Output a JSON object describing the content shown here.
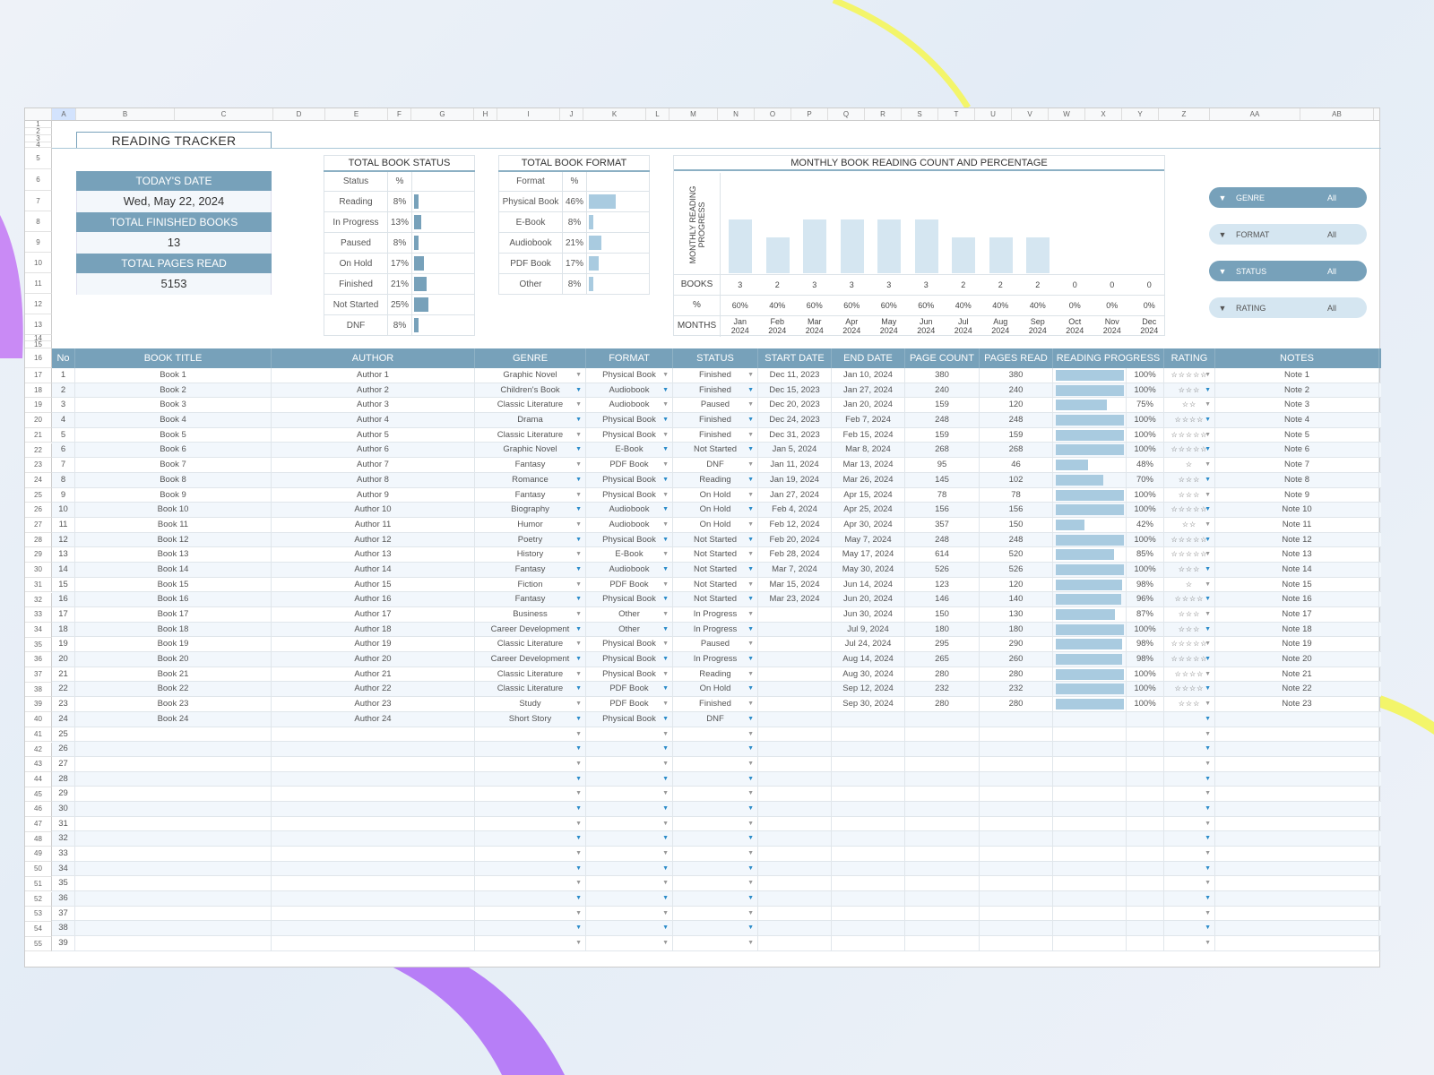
{
  "sheet": {
    "columns": [
      "A",
      "B",
      "C",
      "D",
      "E",
      "F",
      "G",
      "H",
      "I",
      "J",
      "K",
      "L",
      "M",
      "N",
      "O",
      "P",
      "Q",
      "R",
      "S",
      "T",
      "U",
      "V",
      "W",
      "X",
      "Y",
      "Z",
      "AA",
      "AB"
    ],
    "title": "READING TRACKER"
  },
  "kpis": {
    "today_label": "TODAY'S DATE",
    "today_value": "Wed, May 22, 2024",
    "finished_label": "TOTAL FINISHED BOOKS",
    "finished_value": "13",
    "pages_label": "TOTAL PAGES READ",
    "pages_value": "5153"
  },
  "status_summary": {
    "title": "TOTAL BOOK STATUS",
    "col_status": "Status",
    "col_pct": "%",
    "rows": [
      {
        "label": "Reading",
        "pct": "8%",
        "value": 8
      },
      {
        "label": "In Progress",
        "pct": "13%",
        "value": 13
      },
      {
        "label": "Paused",
        "pct": "8%",
        "value": 8
      },
      {
        "label": "On Hold",
        "pct": "17%",
        "value": 17
      },
      {
        "label": "Finished",
        "pct": "21%",
        "value": 21
      },
      {
        "label": "Not Started",
        "pct": "25%",
        "value": 25
      },
      {
        "label": "DNF",
        "pct": "8%",
        "value": 8
      }
    ]
  },
  "format_summary": {
    "title": "TOTAL BOOK FORMAT",
    "col_format": "Format",
    "col_pct": "%",
    "rows": [
      {
        "label": "Physical Book",
        "pct": "46%",
        "value": 46
      },
      {
        "label": "E-Book",
        "pct": "8%",
        "value": 8
      },
      {
        "label": "Audiobook",
        "pct": "21%",
        "value": 21
      },
      {
        "label": "PDF Book",
        "pct": "17%",
        "value": 17
      },
      {
        "label": "Other",
        "pct": "8%",
        "value": 8
      }
    ]
  },
  "chart_data": {
    "type": "bar",
    "title": "MONTHLY BOOK READING COUNT AND PERCENTAGE",
    "ylabel": "MONTHLY READING PROGRESS",
    "row_labels": {
      "books": "BOOKS",
      "pct": "%",
      "months": "MONTHS"
    },
    "categories": [
      "Jan 2024",
      "Feb 2024",
      "Mar 2024",
      "Apr 2024",
      "May 2024",
      "Jun 2024",
      "Jul 2024",
      "Aug 2024",
      "Sep 2024",
      "Oct 2024",
      "Nov 2024",
      "Dec 2024"
    ],
    "values": [
      3,
      2,
      3,
      3,
      3,
      3,
      2,
      2,
      2,
      0,
      0,
      0
    ],
    "percentages": [
      "60%",
      "40%",
      "60%",
      "60%",
      "60%",
      "60%",
      "40%",
      "40%",
      "40%",
      "0%",
      "0%",
      "0%"
    ],
    "ylim": [
      0,
      5
    ]
  },
  "slicers": [
    {
      "name": "GENRE",
      "value": "All"
    },
    {
      "name": "FORMAT",
      "value": "All"
    },
    {
      "name": "STATUS",
      "value": "All"
    },
    {
      "name": "RATING",
      "value": "All"
    }
  ],
  "table": {
    "headers": [
      "No",
      "BOOK TITLE",
      "AUTHOR",
      "GENRE",
      "FORMAT",
      "STATUS",
      "START DATE",
      "END DATE",
      "PAGE COUNT",
      "PAGES READ",
      "READING PROGRESS",
      "RATING",
      "NOTES"
    ],
    "rows": [
      {
        "no": "1",
        "title": "Book 1",
        "author": "Author 1",
        "genre": "Graphic Novel",
        "format": "Physical Book",
        "status": "Finished",
        "start": "Dec 11, 2023",
        "end": "Jan 10, 2024",
        "pages": "380",
        "read": "380",
        "progress": 100,
        "progress_label": "100%",
        "rating": "☆☆☆☆☆",
        "note": "Note 1"
      },
      {
        "no": "2",
        "title": "Book 2",
        "author": "Author 2",
        "genre": "Children's Book",
        "format": "Audiobook",
        "status": "Finished",
        "start": "Dec 15, 2023",
        "end": "Jan 27, 2024",
        "pages": "240",
        "read": "240",
        "progress": 100,
        "progress_label": "100%",
        "rating": "☆☆☆",
        "note": "Note 2"
      },
      {
        "no": "3",
        "title": "Book 3",
        "author": "Author 3",
        "genre": "Classic Literature",
        "format": "Audiobook",
        "status": "Paused",
        "start": "Dec 20, 2023",
        "end": "Jan 20, 2024",
        "pages": "159",
        "read": "120",
        "progress": 75,
        "progress_label": "75%",
        "rating": "☆☆",
        "note": "Note 3"
      },
      {
        "no": "4",
        "title": "Book 4",
        "author": "Author 4",
        "genre": "Drama",
        "format": "Physical Book",
        "status": "Finished",
        "start": "Dec 24, 2023",
        "end": "Feb 7, 2024",
        "pages": "248",
        "read": "248",
        "progress": 100,
        "progress_label": "100%",
        "rating": "☆☆☆☆",
        "note": "Note 4"
      },
      {
        "no": "5",
        "title": "Book 5",
        "author": "Author 5",
        "genre": "Classic Literature",
        "format": "Physical Book",
        "status": "Finished",
        "start": "Dec 31, 2023",
        "end": "Feb 15, 2024",
        "pages": "159",
        "read": "159",
        "progress": 100,
        "progress_label": "100%",
        "rating": "☆☆☆☆☆",
        "note": "Note 5"
      },
      {
        "no": "6",
        "title": "Book 6",
        "author": "Author 6",
        "genre": "Graphic Novel",
        "format": "E-Book",
        "status": "Not Started",
        "start": "Jan 5, 2024",
        "end": "Mar 8, 2024",
        "pages": "268",
        "read": "268",
        "progress": 100,
        "progress_label": "100%",
        "rating": "☆☆☆☆☆",
        "note": "Note 6"
      },
      {
        "no": "7",
        "title": "Book 7",
        "author": "Author 7",
        "genre": "Fantasy",
        "format": "PDF Book",
        "status": "DNF",
        "start": "Jan 11, 2024",
        "end": "Mar 13, 2024",
        "pages": "95",
        "read": "46",
        "progress": 48,
        "progress_label": "48%",
        "rating": "☆",
        "note": "Note 7"
      },
      {
        "no": "8",
        "title": "Book 8",
        "author": "Author 8",
        "genre": "Romance",
        "format": "Physical Book",
        "status": "Reading",
        "start": "Jan 19, 2024",
        "end": "Mar 26, 2024",
        "pages": "145",
        "read": "102",
        "progress": 70,
        "progress_label": "70%",
        "rating": "☆☆☆",
        "note": "Note 8"
      },
      {
        "no": "9",
        "title": "Book 9",
        "author": "Author 9",
        "genre": "Fantasy",
        "format": "Physical Book",
        "status": "On Hold",
        "start": "Jan 27, 2024",
        "end": "Apr 15, 2024",
        "pages": "78",
        "read": "78",
        "progress": 100,
        "progress_label": "100%",
        "rating": "☆☆☆",
        "note": "Note 9"
      },
      {
        "no": "10",
        "title": "Book 10",
        "author": "Author 10",
        "genre": "Biography",
        "format": "Audiobook",
        "status": "On Hold",
        "start": "Feb 4, 2024",
        "end": "Apr 25, 2024",
        "pages": "156",
        "read": "156",
        "progress": 100,
        "progress_label": "100%",
        "rating": "☆☆☆☆☆",
        "note": "Note 10"
      },
      {
        "no": "11",
        "title": "Book 11",
        "author": "Author 11",
        "genre": "Humor",
        "format": "Audiobook",
        "status": "On Hold",
        "start": "Feb 12, 2024",
        "end": "Apr 30, 2024",
        "pages": "357",
        "read": "150",
        "progress": 42,
        "progress_label": "42%",
        "rating": "☆☆",
        "note": "Note 11"
      },
      {
        "no": "12",
        "title": "Book 12",
        "author": "Author 12",
        "genre": "Poetry",
        "format": "Physical Book",
        "status": "Not Started",
        "start": "Feb 20, 2024",
        "end": "May 7, 2024",
        "pages": "248",
        "read": "248",
        "progress": 100,
        "progress_label": "100%",
        "rating": "☆☆☆☆☆",
        "note": "Note 12"
      },
      {
        "no": "13",
        "title": "Book 13",
        "author": "Author 13",
        "genre": "History",
        "format": "E-Book",
        "status": "Not Started",
        "start": "Feb 28, 2024",
        "end": "May 17, 2024",
        "pages": "614",
        "read": "520",
        "progress": 85,
        "progress_label": "85%",
        "rating": "☆☆☆☆☆",
        "note": "Note 13"
      },
      {
        "no": "14",
        "title": "Book 14",
        "author": "Author 14",
        "genre": "Fantasy",
        "format": "Audiobook",
        "status": "Not Started",
        "start": "Mar 7, 2024",
        "end": "May 30, 2024",
        "pages": "526",
        "read": "526",
        "progress": 100,
        "progress_label": "100%",
        "rating": "☆☆☆",
        "note": "Note 14"
      },
      {
        "no": "15",
        "title": "Book 15",
        "author": "Author 15",
        "genre": "Fiction",
        "format": "PDF Book",
        "status": "Not Started",
        "start": "Mar 15, 2024",
        "end": "Jun 14, 2024",
        "pages": "123",
        "read": "120",
        "progress": 98,
        "progress_label": "98%",
        "rating": "☆",
        "note": "Note 15"
      },
      {
        "no": "16",
        "title": "Book 16",
        "author": "Author 16",
        "genre": "Fantasy",
        "format": "Physical Book",
        "status": "Not Started",
        "start": "Mar 23, 2024",
        "end": "Jun 20, 2024",
        "pages": "146",
        "read": "140",
        "progress": 96,
        "progress_label": "96%",
        "rating": "☆☆☆☆",
        "note": "Note 16"
      },
      {
        "no": "17",
        "title": "Book 17",
        "author": "Author 17",
        "genre": "Business",
        "format": "Other",
        "status": "In Progress",
        "start": "",
        "end": "Jun 30, 2024",
        "pages": "150",
        "read": "130",
        "progress": 87,
        "progress_label": "87%",
        "rating": "☆☆☆",
        "note": "Note 17"
      },
      {
        "no": "18",
        "title": "Book 18",
        "author": "Author 18",
        "genre": "Career Development",
        "format": "Other",
        "status": "In Progress",
        "start": "",
        "end": "Jul 9, 2024",
        "pages": "180",
        "read": "180",
        "progress": 100,
        "progress_label": "100%",
        "rating": "☆☆☆",
        "note": "Note 18"
      },
      {
        "no": "19",
        "title": "Book 19",
        "author": "Author 19",
        "genre": "Classic Literature",
        "format": "Physical Book",
        "status": "Paused",
        "start": "",
        "end": "Jul 24, 2024",
        "pages": "295",
        "read": "290",
        "progress": 98,
        "progress_label": "98%",
        "rating": "☆☆☆☆☆",
        "note": "Note 19"
      },
      {
        "no": "20",
        "title": "Book 20",
        "author": "Author 20",
        "genre": "Career Development",
        "format": "Physical Book",
        "status": "In Progress",
        "start": "",
        "end": "Aug 14, 2024",
        "pages": "265",
        "read": "260",
        "progress": 98,
        "progress_label": "98%",
        "rating": "☆☆☆☆☆",
        "note": "Note 20"
      },
      {
        "no": "21",
        "title": "Book 21",
        "author": "Author 21",
        "genre": "Classic Literature",
        "format": "Physical Book",
        "status": "Reading",
        "start": "",
        "end": "Aug 30, 2024",
        "pages": "280",
        "read": "280",
        "progress": 100,
        "progress_label": "100%",
        "rating": "☆☆☆☆",
        "note": "Note 21"
      },
      {
        "no": "22",
        "title": "Book 22",
        "author": "Author 22",
        "genre": "Classic Literature",
        "format": "PDF Book",
        "status": "On Hold",
        "start": "",
        "end": "Sep 12, 2024",
        "pages": "232",
        "read": "232",
        "progress": 100,
        "progress_label": "100%",
        "rating": "☆☆☆☆",
        "note": "Note 22"
      },
      {
        "no": "23",
        "title": "Book 23",
        "author": "Author 23",
        "genre": "Study",
        "format": "PDF Book",
        "status": "Finished",
        "start": "",
        "end": "Sep 30, 2024",
        "pages": "280",
        "read": "280",
        "progress": 100,
        "progress_label": "100%",
        "rating": "☆☆☆",
        "note": "Note 23"
      },
      {
        "no": "24",
        "title": "Book 24",
        "author": "Author 24",
        "genre": "Short Story",
        "format": "Physical Book",
        "status": "DNF",
        "start": "",
        "end": "",
        "pages": "",
        "read": "",
        "progress": null,
        "progress_label": "",
        "rating": "",
        "note": ""
      },
      {
        "no": "25"
      },
      {
        "no": "26"
      },
      {
        "no": "27"
      },
      {
        "no": "28"
      },
      {
        "no": "29"
      },
      {
        "no": "30"
      },
      {
        "no": "31"
      },
      {
        "no": "32"
      },
      {
        "no": "33"
      },
      {
        "no": "34"
      },
      {
        "no": "35"
      },
      {
        "no": "36"
      },
      {
        "no": "37"
      },
      {
        "no": "38"
      },
      {
        "no": "39"
      }
    ]
  },
  "colors": {
    "header_bg": "#77a1ba",
    "accent_light": "#d5e6f1",
    "progress_bar": "#a9cbe0",
    "dropdown_blue": "#2a8bc9"
  }
}
